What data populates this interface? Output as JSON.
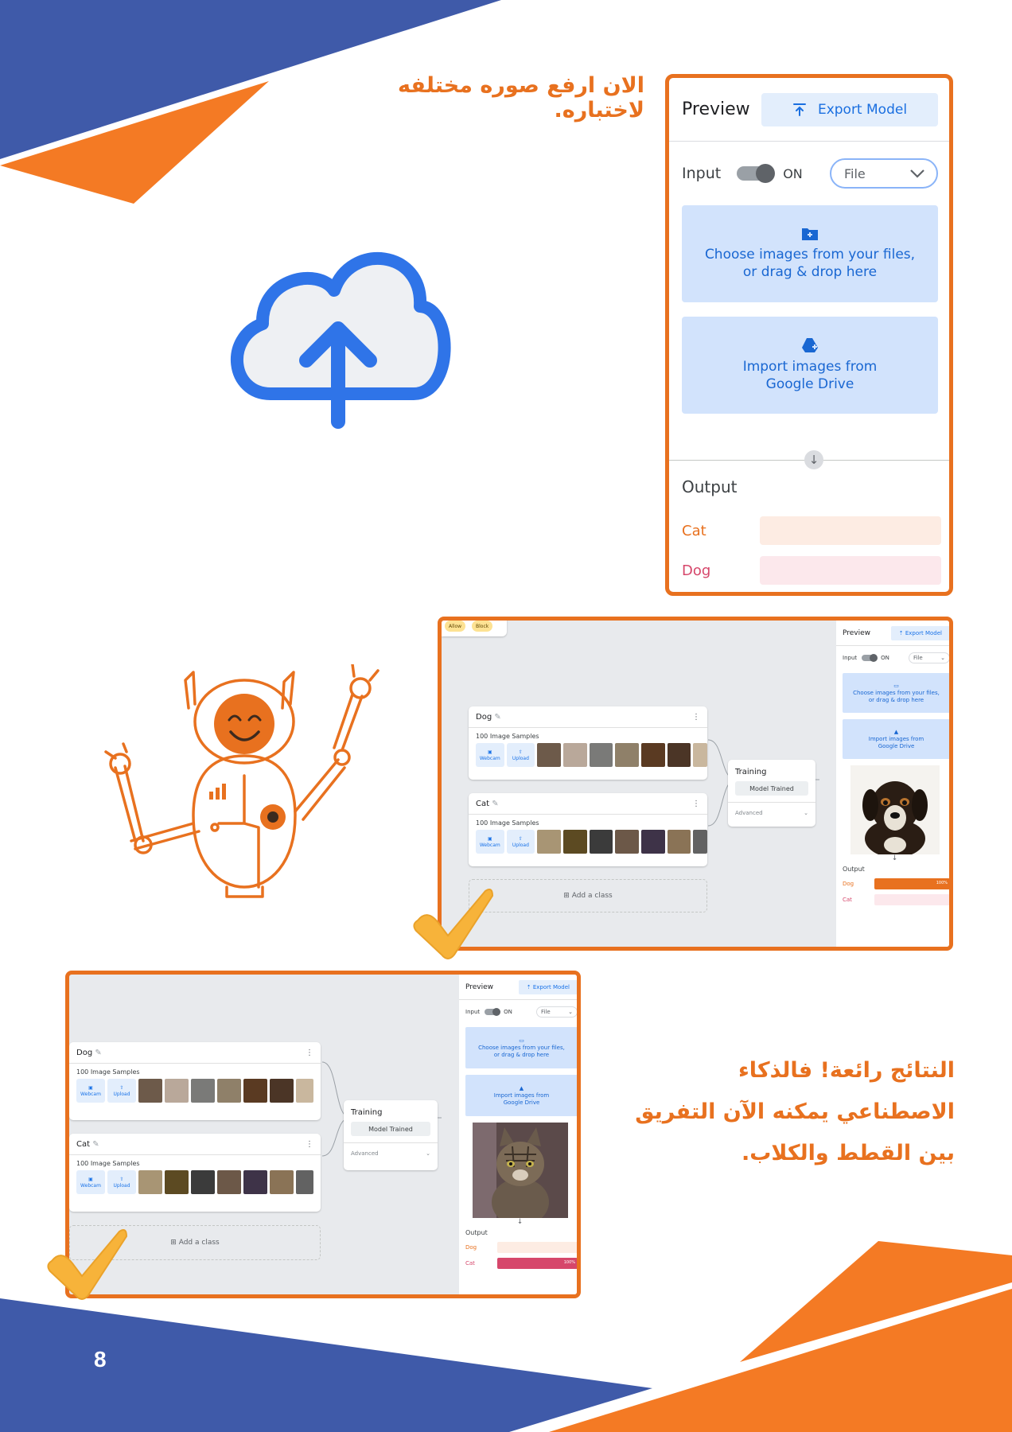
{
  "headings": {
    "top": "الان ارفع صوره مختلفه لاختباره.",
    "bottom": [
      "النتائج رائعة! فالذكاء",
      "الاصطناعي يمكنه الآن التفريق",
      "بين القطط والكلاب."
    ]
  },
  "page_number": "8",
  "colors": {
    "orange": "#e8711f",
    "blue": "#3f5aa9",
    "light_blue": "#d2e3fc",
    "cat_orange": "#e8711f",
    "dog_pink": "#d6476b"
  },
  "icons": [
    "cloud-upload-icon",
    "robot-illustration",
    "checkmark-icon",
    "folder-icon",
    "google-drive-icon",
    "export-icon",
    "chevron-down-icon",
    "arrow-down-icon",
    "edit-pencil-icon",
    "more-vert-icon",
    "webcam-icon",
    "upload-icon",
    "add-box-icon"
  ],
  "big_preview": {
    "title": "Preview",
    "export_label": "Export Model",
    "input_label": "Input",
    "toggle_label": "ON",
    "file_select": "File",
    "choose_files": [
      "Choose images from your files,",
      "or drag & drop here"
    ],
    "import_drive": [
      "Import images from",
      "Google Drive"
    ],
    "output_title": "Output",
    "outputs": [
      {
        "label": "Cat",
        "value": 0
      },
      {
        "label": "Dog",
        "value": 0
      }
    ]
  },
  "shot_dog": {
    "chips": [
      "Allow",
      "Block"
    ],
    "classes": [
      {
        "name": "Dog",
        "samples": "100 Image Samples",
        "webcam": "Webcam",
        "upload": "Upload"
      },
      {
        "name": "Cat",
        "samples": "100 Image Samples",
        "webcam": "Webcam",
        "upload": "Upload"
      }
    ],
    "add_class": "Add a class",
    "training": {
      "title": "Training",
      "button": "Model Trained",
      "advanced": "Advanced"
    },
    "preview": {
      "title": "Preview",
      "export": "Export Model",
      "input": "Input",
      "on": "ON",
      "file": "File",
      "choose": [
        "Choose images from your files,",
        "or drag & drop here"
      ],
      "drive": [
        "Import images from",
        "Google Drive"
      ],
      "output": "Output",
      "results": [
        {
          "label": "Dog",
          "value": 100,
          "pct": "100%"
        },
        {
          "label": "Cat",
          "value": 0
        }
      ]
    }
  },
  "shot_cat": {
    "classes": [
      {
        "name": "Dog",
        "samples": "100 Image Samples",
        "webcam": "Webcam",
        "upload": "Upload"
      },
      {
        "name": "Cat",
        "samples": "100 Image Samples",
        "webcam": "Webcam",
        "upload": "Upload"
      }
    ],
    "add_class": "Add a class",
    "training": {
      "title": "Training",
      "button": "Model Trained",
      "advanced": "Advanced"
    },
    "preview": {
      "title": "Preview",
      "export": "Export Model",
      "input": "Input",
      "on": "ON",
      "file": "File",
      "choose": [
        "Choose images from your files,",
        "or drag & drop here"
      ],
      "drive": [
        "Import images from",
        "Google Drive"
      ],
      "output": "Output",
      "results": [
        {
          "label": "Dog",
          "value": 0
        },
        {
          "label": "Cat",
          "value": 100,
          "pct": "100%"
        }
      ]
    }
  }
}
